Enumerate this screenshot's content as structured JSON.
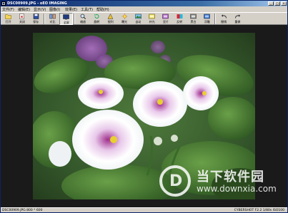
{
  "window": {
    "title": "DSC00909.JPG - oEO IMAGING"
  },
  "title_buttons": [
    "_",
    "□",
    "×"
  ],
  "menu": [
    {
      "label": "文件(F)"
    },
    {
      "label": "编辑(E)"
    },
    {
      "label": "显示(V)"
    },
    {
      "label": "图像(I)"
    },
    {
      "label": "效果(E)"
    },
    {
      "label": "工具(T)"
    },
    {
      "label": "帮助(H)"
    }
  ],
  "toolbar": [
    {
      "label": "打开",
      "icon": "open-folder-icon"
    },
    {
      "label": "关闭",
      "icon": "close-file-icon"
    },
    {
      "label": "保存",
      "icon": "save-icon"
    },
    {
      "label": "对比",
      "icon": "compare-icon"
    },
    {
      "label": "全屏",
      "icon": "fullscreen-icon",
      "active": true
    },
    {
      "label": "缩放",
      "icon": "zoom-icon"
    },
    {
      "label": "旋转",
      "icon": "rotate-icon"
    },
    {
      "label": "锐利",
      "icon": "sharpen-icon"
    },
    {
      "label": "曝光",
      "icon": "exposure-icon"
    },
    {
      "label": "自动",
      "icon": "auto-icon"
    },
    {
      "label": "补光",
      "icon": "fill-light-icon"
    },
    {
      "label": "亚片",
      "icon": "film-icon"
    },
    {
      "label": "反转",
      "icon": "invert-icon"
    },
    {
      "label": "黑白",
      "icon": "grayscale-icon"
    },
    {
      "label": "浮雕",
      "icon": "emboss-icon"
    },
    {
      "label": "撤销",
      "icon": "undo-icon"
    },
    {
      "label": "重做",
      "icon": "redo-icon"
    }
  ],
  "watermark": {
    "title": "当下软件园",
    "url": "www.downxia.com",
    "logo_glyph": "D"
  },
  "status": {
    "left": "DSC00909.JPG  800 * 600",
    "right": "CYBERSHOT F2.2 1/80s ISO100"
  },
  "colors": {
    "titlebar_start": "#0a246a",
    "chrome": "#d4d0c8",
    "background": "#1a1a1a"
  }
}
